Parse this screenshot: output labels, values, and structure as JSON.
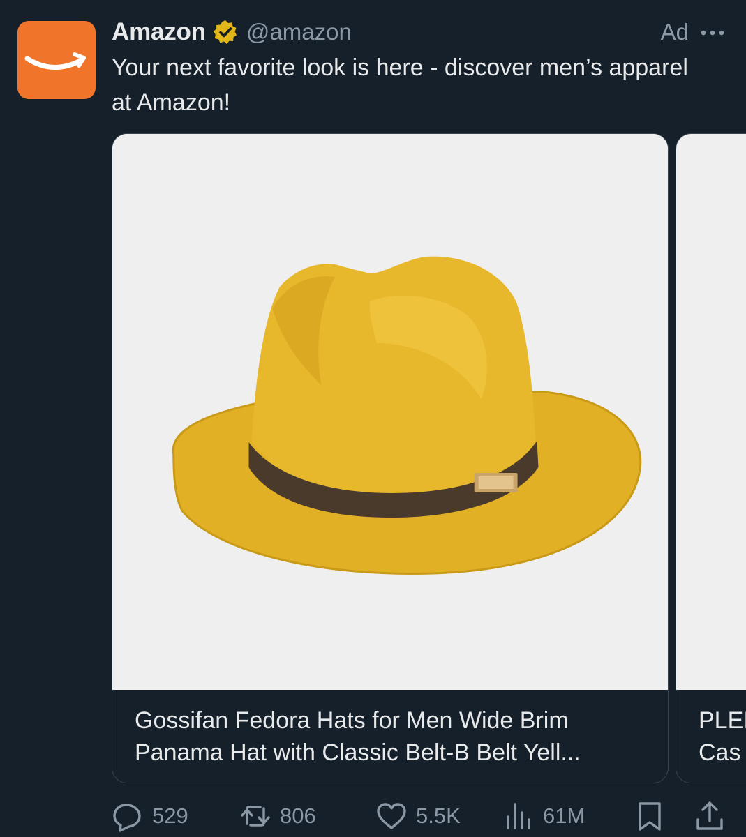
{
  "account": {
    "name": "Amazon",
    "handle": "@amazon",
    "verified": true,
    "brand_color": "#f0752a",
    "avatar_icon": "amazon-smile-logo"
  },
  "ad_label": "Ad",
  "text": "Your next favorite look is here - discover men’s apparel at Amazon!",
  "carousel": [
    {
      "caption": "Gossifan Fedora Hats for Men Wide Brim\nPanama Hat with Classic Belt-B Belt Yell...",
      "image": "yellow-fedora-hat-with-brown-belt"
    },
    {
      "caption": "PLEI\nCas"
    }
  ],
  "actions": {
    "replies": "529",
    "reposts": "806",
    "likes": "5.5K",
    "views": "61M"
  },
  "colors": {
    "background": "#15202b",
    "text": "#e7e9ea",
    "muted": "#8b98a5",
    "verified_gold": "#e2b719",
    "hat_yellow": "#e6b52a"
  }
}
